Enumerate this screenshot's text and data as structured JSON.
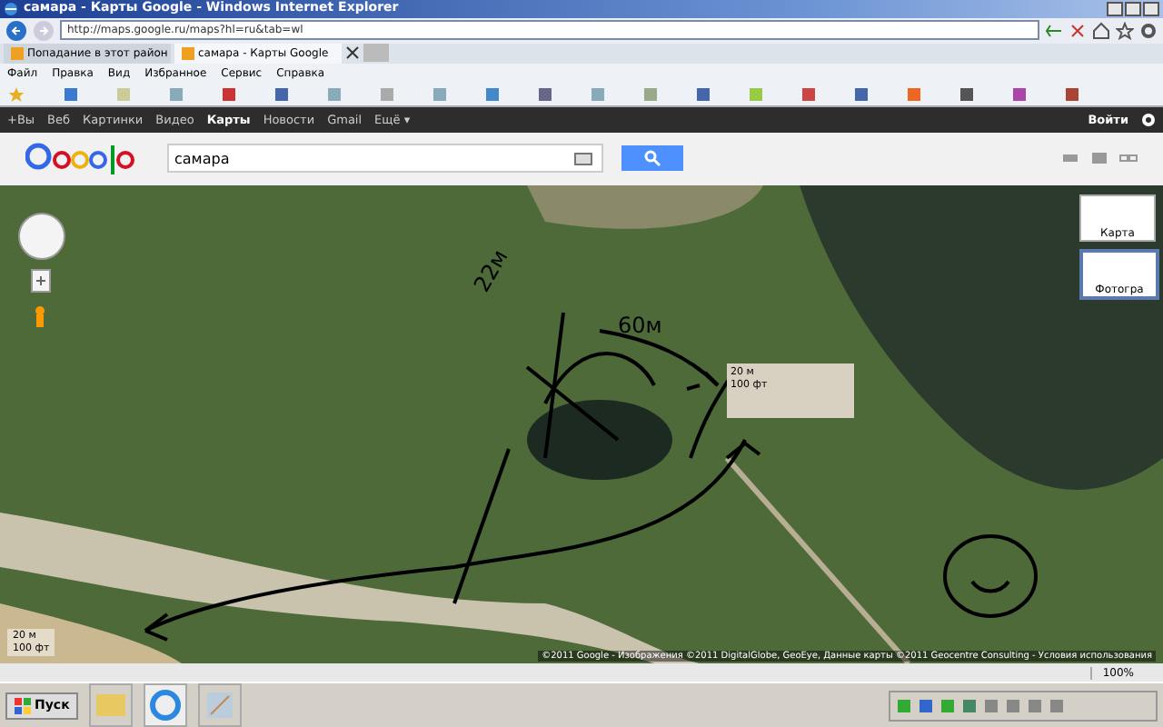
{
  "window": {
    "title": "самара - Карты Google - Windows Internet Explorer"
  },
  "address_bar": {
    "value": "http://maps.google.ru/maps?hl=ru&tab=wl"
  },
  "tabs": [
    {
      "label": "Попадание в этот район",
      "selected": false
    },
    {
      "label": "самара - Карты Google",
      "selected": true
    }
  ],
  "menu": [
    "Файл",
    "Правка",
    "Вид",
    "Избранное",
    "Сервис",
    "Справка"
  ],
  "google_bar": {
    "links": [
      {
        "label": "+Вы",
        "selected": false
      },
      {
        "label": "Веб",
        "selected": false
      },
      {
        "label": "Картинки",
        "selected": false
      },
      {
        "label": "Видео",
        "selected": false
      },
      {
        "label": "Карты",
        "selected": true
      },
      {
        "label": "Новости",
        "selected": false
      },
      {
        "label": "Gmail",
        "selected": false
      },
      {
        "label": "Ещё ▾",
        "selected": false
      }
    ],
    "sign_in": "Войти"
  },
  "search": {
    "value": "самара"
  },
  "map": {
    "annotations": [
      "22м",
      "60м"
    ],
    "inset_scale": [
      "20 м",
      "100 фт"
    ],
    "scale": [
      "20 м",
      "100 фт"
    ],
    "view_types": [
      {
        "label": "Карта",
        "selected": false
      },
      {
        "label": "Фотогра",
        "selected": true
      }
    ],
    "copyright": "©2011 Google - Изображения ©2011 DigitalGlobe, GeoEye, Данные карты ©2011 Geocentre Consulting - Условия использования"
  },
  "status_bar": {
    "zoom": "100%"
  },
  "taskbar": {
    "start": "Пуск"
  }
}
